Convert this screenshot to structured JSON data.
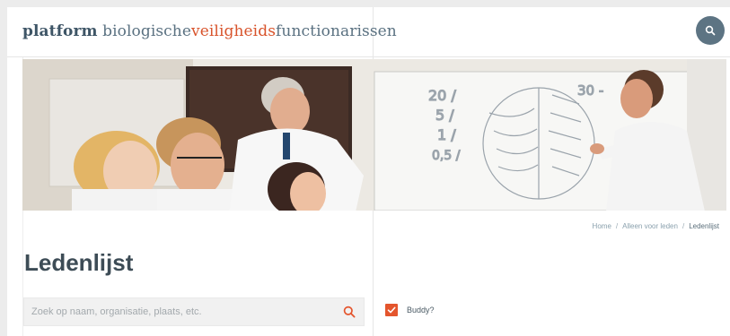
{
  "header": {
    "logo": {
      "part1": "platform",
      "part2": " biologische",
      "part3": "veiligheids",
      "part4": "functionarissen"
    },
    "search_icon": "search-icon",
    "colors": {
      "brand_dark": "#3e5566",
      "accent": "#d8532b",
      "button": "#5d7483"
    }
  },
  "breadcrumb": {
    "items": [
      "Home",
      "Alleen voor leden"
    ],
    "separator": "/",
    "current": "Ledenlijst"
  },
  "page_title": "Ledenlijst",
  "search": {
    "placeholder": "Zoek op naam, organisatie, plaats, etc.",
    "value": "",
    "icon": "search-icon",
    "icon_color": "#e4552d"
  },
  "filter": {
    "buddy_label": "Buddy?",
    "buddy_checked": true,
    "checkbox_color": "#e4552d"
  }
}
